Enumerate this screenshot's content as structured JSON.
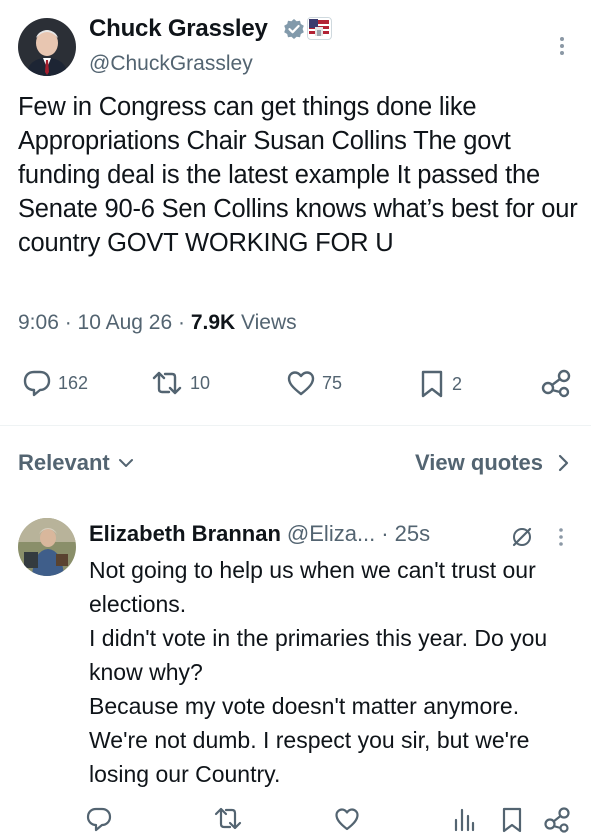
{
  "tweet": {
    "author_name": "Chuck Grassley",
    "author_handle": "@ChuckGrassley",
    "text": "Few in Congress can get things done like Appropriations Chair Susan Collins The govt funding deal is the latest example It passed the Senate 90-6 Sen Collins knows what’s best for our country GOVT WORKING FOR U",
    "time": "9:06",
    "date": "10 Aug 26",
    "views_count": "7.9K",
    "views_label": "Views",
    "actions": {
      "replies": "162",
      "reposts": "10",
      "likes": "75",
      "bookmarks": "2"
    }
  },
  "sort_bar": {
    "relevant_label": "Relevant",
    "view_quotes_label": "View quotes"
  },
  "reply": {
    "author_name": "Elizabeth Brannan",
    "author_handle": "@Eliza...",
    "time": "25s",
    "text": "Not going to help us when we can't trust our elections.\nI didn't vote in the primaries this year. Do you know why?\nBecause my vote doesn't matter anymore. We're not dumb. I respect you sir, but we're losing our Country."
  },
  "icons": {
    "verified": "verified-badge-icon",
    "affiliation": "government-affiliation-icon",
    "more": "more-vertical-icon",
    "reply": "reply-bubble-icon",
    "repost": "repost-icon",
    "like": "heart-icon",
    "bookmark": "bookmark-icon",
    "share": "share-icon",
    "views": "views-bars-icon",
    "grok": "grok-icon",
    "chevron_down": "chevron-down-icon",
    "chevron_right": "chevron-right-icon"
  },
  "colors": {
    "text_primary": "#0f1419",
    "text_secondary": "#536471",
    "verified_badge": "#829aab",
    "divider": "#eff3f4"
  }
}
